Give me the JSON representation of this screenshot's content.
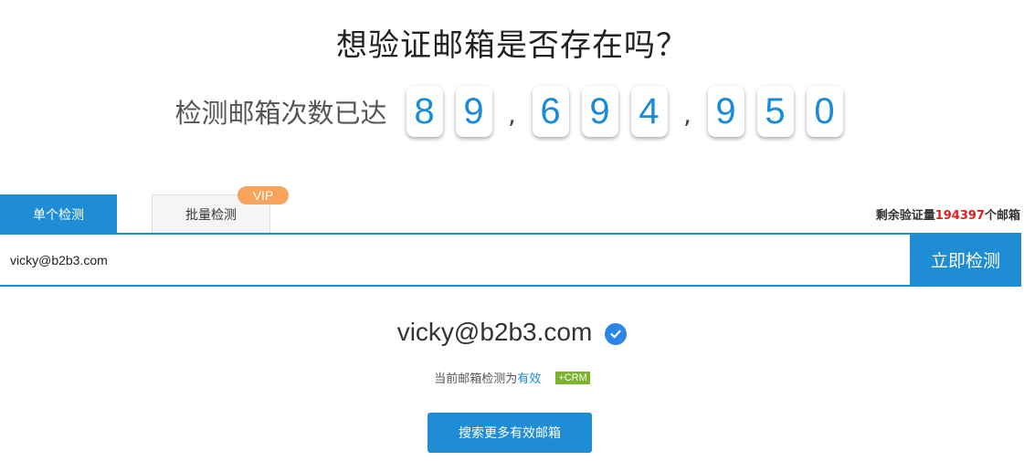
{
  "header": {
    "title": "想验证邮箱是否存在吗？"
  },
  "counter": {
    "label": "检测邮箱次数已达",
    "digits": [
      "8",
      "9",
      ",",
      "6",
      "9",
      "4",
      ",",
      "9",
      "5",
      "0"
    ]
  },
  "tabs": [
    {
      "label": "单个检测",
      "active": true
    },
    {
      "label": "批量检测",
      "active": false
    }
  ],
  "vip_badge": "VIP",
  "remaining": {
    "prefix": "剩余验证量",
    "count": "194397",
    "suffix": "个邮箱"
  },
  "search": {
    "value": "vicky@b2b3.com",
    "button_label": "立即检测"
  },
  "result": {
    "email": "vicky@b2b3.com",
    "status_prefix": "当前邮箱检测为",
    "status_value": "有效",
    "crm_badge": "+CRM"
  },
  "more_button_label": "搜索更多有效邮箱",
  "colors": {
    "accent": "#1f8dd6",
    "vip": "#f7a35c",
    "remaining_count": "#e02020",
    "crm": "#7cb32c",
    "check": "#2b86e8"
  },
  "icons": {
    "result_status": "check-circle-icon"
  }
}
